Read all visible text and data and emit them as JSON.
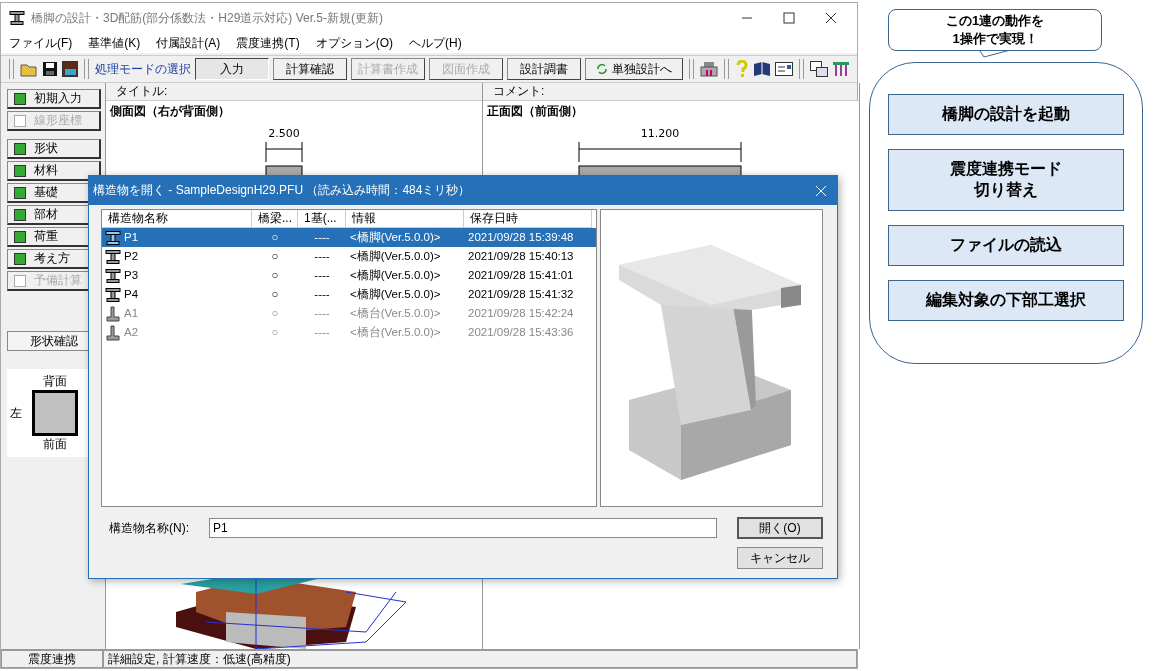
{
  "window": {
    "title": "橋脚の設計・3D配筋(部分係数法・H29道示対応) Ver.5-新規(更新)"
  },
  "menu": [
    "ファイル(F)",
    "基準値(K)",
    "付属設計(A)",
    "震度連携(T)",
    "オプション(O)",
    "ヘルプ(H)"
  ],
  "toolbar": {
    "mode_label": "処理モードの選択",
    "modes": [
      {
        "label": "入力",
        "selected": true,
        "disabled": false
      },
      {
        "label": "計算確認",
        "selected": false,
        "disabled": false
      },
      {
        "label": "計算書作成",
        "selected": false,
        "disabled": true
      },
      {
        "label": "図面作成",
        "selected": false,
        "disabled": true
      },
      {
        "label": "設計調書",
        "selected": false,
        "disabled": false
      }
    ],
    "standalone_button": "単独設計へ"
  },
  "sidebar": {
    "groups": [
      [
        {
          "label": "初期入力",
          "checked": true,
          "disabled": false
        },
        {
          "label": "線形座標",
          "checked": false,
          "disabled": true
        }
      ],
      [
        {
          "label": "形状",
          "checked": true,
          "disabled": false
        },
        {
          "label": "材料",
          "checked": true,
          "disabled": false
        },
        {
          "label": "基礎",
          "checked": true,
          "disabled": false
        },
        {
          "label": "部材",
          "checked": true,
          "disabled": false
        },
        {
          "label": "荷重",
          "checked": true,
          "disabled": false
        },
        {
          "label": "考え方",
          "checked": true,
          "disabled": false
        },
        {
          "label": "予備計算",
          "checked": false,
          "disabled": true
        }
      ]
    ],
    "shape_check_button": "形状確認",
    "orientation": {
      "top": "背面",
      "left": "左",
      "bottom": "前面"
    }
  },
  "panes": [
    {
      "header": "タイトル:",
      "heading": "側面図（右が背面側）",
      "dimension": "2.500"
    },
    {
      "header": "コメント:",
      "heading": "正面図（前面側）",
      "dimension": "11.200"
    }
  ],
  "dialog": {
    "title": "構造物を開く - SampleDesignH29.PFU （読み込み時間：484ミリ秒）",
    "columns": [
      "構造物名称",
      "橋梁...",
      "1基(...",
      "情報",
      "保存日時"
    ],
    "rows": [
      {
        "kind": "pier",
        "name": "P1",
        "bridge": "○",
        "unit": "----",
        "info": "<橋脚(Ver.5.0.0)>",
        "saved": "2021/09/28 15:39:48",
        "selected": true,
        "disabled": false
      },
      {
        "kind": "pier",
        "name": "P2",
        "bridge": "○",
        "unit": "----",
        "info": "<橋脚(Ver.5.0.0)>",
        "saved": "2021/09/28 15:40:13",
        "selected": false,
        "disabled": false
      },
      {
        "kind": "pier",
        "name": "P3",
        "bridge": "○",
        "unit": "----",
        "info": "<橋脚(Ver.5.0.0)>",
        "saved": "2021/09/28 15:41:01",
        "selected": false,
        "disabled": false
      },
      {
        "kind": "pier",
        "name": "P4",
        "bridge": "○",
        "unit": "----",
        "info": "<橋脚(Ver.5.0.0)>",
        "saved": "2021/09/28 15:41:32",
        "selected": false,
        "disabled": false
      },
      {
        "kind": "abutment",
        "name": "A1",
        "bridge": "○",
        "unit": "----",
        "info": "<橋台(Ver.5.0.0)>",
        "saved": "2021/09/28 15:42:24",
        "selected": false,
        "disabled": true
      },
      {
        "kind": "abutment",
        "name": "A2",
        "bridge": "○",
        "unit": "----",
        "info": "<橋台(Ver.5.0.0)>",
        "saved": "2021/09/28 15:43:36",
        "selected": false,
        "disabled": true
      }
    ],
    "name_label": "構造物名称(N):",
    "name_value": "P1",
    "open_button": "開く(O)",
    "cancel_button": "キャンセル"
  },
  "status_bar": {
    "mode": "震度連携",
    "info": "詳細設定, 計算速度：低速(高精度)"
  },
  "callout": {
    "bubble": "この1連の動作を\n1操作で実現！",
    "steps": [
      [
        "橋脚の設計を起動"
      ],
      [
        "震度連携モード",
        "切り替え"
      ],
      [
        "ファイルの読込"
      ],
      [
        "編集対象の下部工選択"
      ]
    ]
  }
}
